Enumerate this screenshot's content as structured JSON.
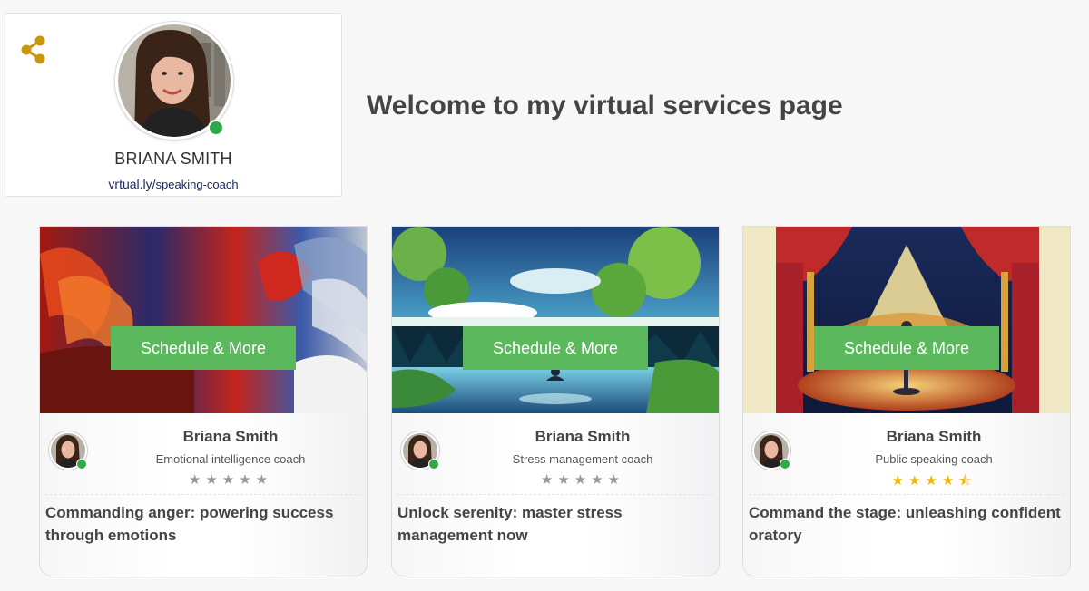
{
  "profile": {
    "name": "BRIANA SMITH",
    "url_domain": "vrtual.ly/",
    "url_path": "speaking-coach",
    "status": "online"
  },
  "welcome_heading": "Welcome to my virtual services page",
  "colors": {
    "accent_green": "#5cb85c",
    "share_icon": "#c9960c",
    "online": "#2eaa4b",
    "star_gold": "#f2b500"
  },
  "cards": [
    {
      "button_label": "Schedule & More",
      "coach_name": "Briana Smith",
      "coach_title": "Emotional intelligence coach",
      "rating": 0,
      "stars": "★★★★★",
      "service_title": "Commanding anger: powering success through emotions"
    },
    {
      "button_label": "Schedule & More",
      "coach_name": "Briana Smith",
      "coach_title": "Stress management coach",
      "rating": 0,
      "stars": "★★★★★",
      "service_title": "Unlock serenity: master stress management now"
    },
    {
      "button_label": "Schedule & More",
      "coach_name": "Briana Smith",
      "coach_title": "Public speaking coach",
      "rating": 4.5,
      "stars": "★★★★⯪",
      "service_title": "Command the stage: unleashing confident oratory"
    }
  ]
}
